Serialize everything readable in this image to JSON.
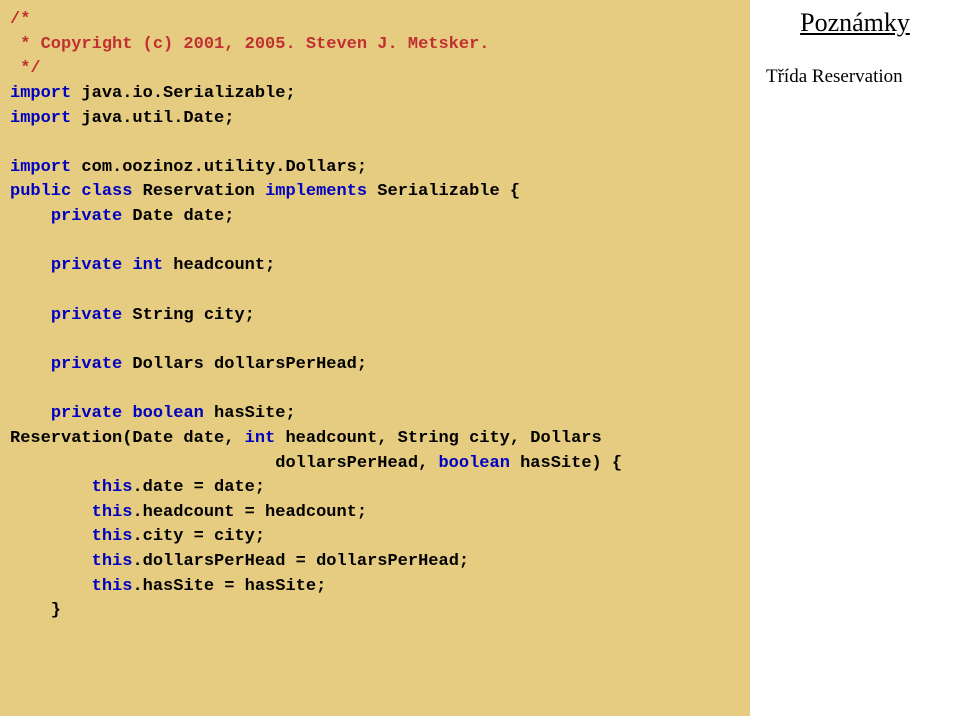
{
  "side": {
    "title": "Poznámky",
    "note": "Třída Reservation"
  },
  "code": {
    "c1": "/*",
    "c2": " * Copyright (c) 2001, 2005. Steven J. Metsker.",
    "c3": " */",
    "k_import": "import",
    "imp_ser": " java.io.Serializable;",
    "imp_date": " java.util.Date;",
    "imp_dollars": " com.oozinoz.utility.Dollars;",
    "k_public": "public",
    "k_class": "class",
    "cls_name": " Reservation ",
    "k_implements": "implements",
    "cls_impl": " Serializable {",
    "k_private": "private",
    "fld_date": " Date date;",
    "k_int": "int",
    "fld_headcount": " headcount;",
    "fld_city": " String city;",
    "fld_dph": " Dollars dollarsPerHead;",
    "k_boolean": "boolean",
    "fld_hassite": " hasSite;",
    "ctor_sig1": "Reservation(Date date, ",
    "ctor_sig2": " headcount, String city, Dollars",
    "ctor_sig3": "                          dollarsPerHead, ",
    "ctor_sig4": " hasSite) {",
    "k_this": "this",
    "a_date": ".date = date;",
    "a_headcount": ".headcount = headcount;",
    "a_city": ".city = city;",
    "a_dph": ".dollarsPerHead = dollarsPerHead;",
    "a_hassite": ".hasSite = hasSite;",
    "close": "    }"
  }
}
